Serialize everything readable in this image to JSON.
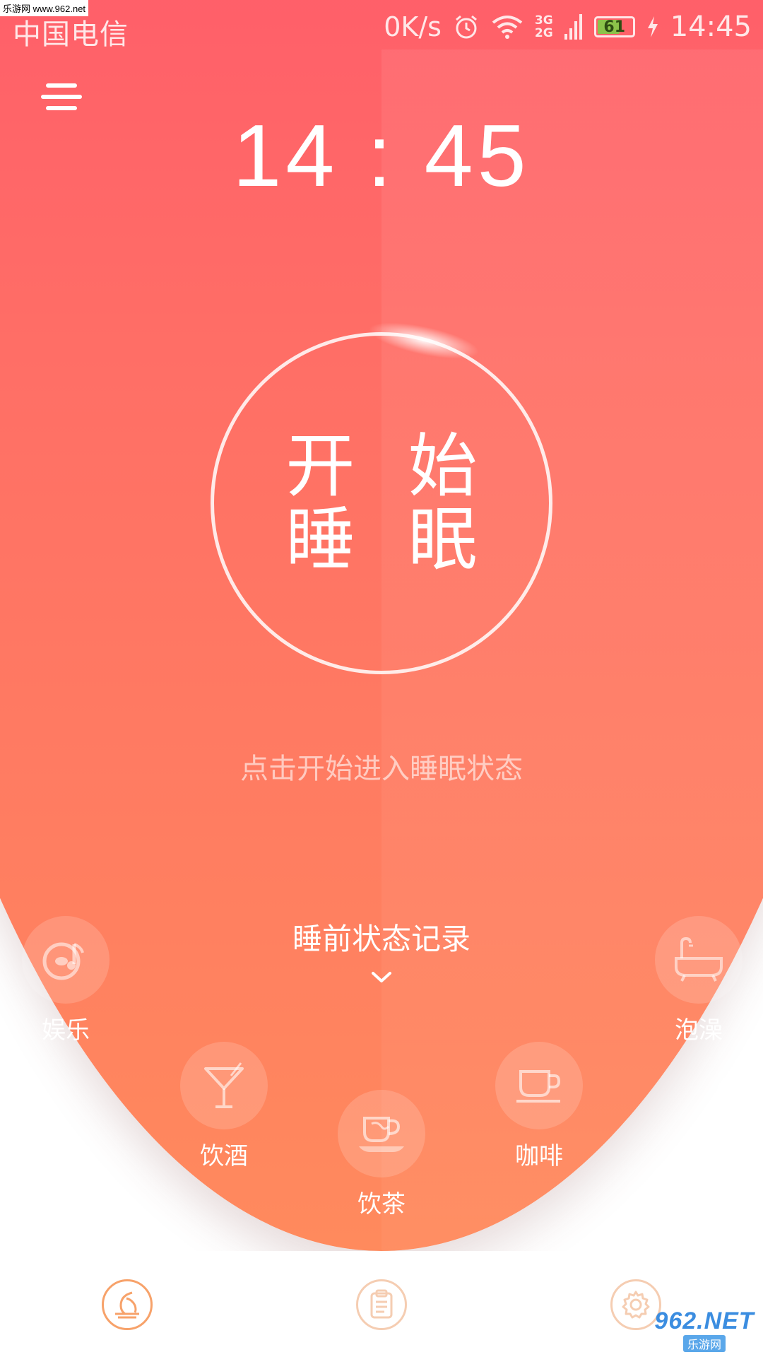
{
  "status_bar": {
    "watermark": "乐游网 www.962.net",
    "carrier": "中国电信",
    "net_speed": "0K/s",
    "network_gen": [
      "3G",
      "2G"
    ],
    "battery_level": "61",
    "time": "14:45"
  },
  "header": {
    "clock": "14 : 45"
  },
  "main": {
    "start_label_line1": "开 始",
    "start_label_line2": "睡 眠",
    "hint": "点击开始进入睡眠状态",
    "record_title": "睡前状态记录"
  },
  "activities": [
    {
      "label": "娱乐",
      "icon": "music-disc-icon"
    },
    {
      "label": "泡澡",
      "icon": "bathtub-icon"
    },
    {
      "label": "饮酒",
      "icon": "cocktail-glass-icon"
    },
    {
      "label": "咖啡",
      "icon": "coffee-cup-icon"
    },
    {
      "label": "饮茶",
      "icon": "tea-cup-icon"
    }
  ],
  "bottom_nav": [
    {
      "icon": "moon-sleep-icon",
      "active": true
    },
    {
      "icon": "clipboard-icon",
      "active": false
    },
    {
      "icon": "gear-icon",
      "active": false
    }
  ],
  "colors": {
    "gradient_top": "#ff5468",
    "gradient_bottom": "#ff8a5d",
    "nav_active": "#f7a26a",
    "nav_inactive": "#f5cdb2"
  },
  "watermark_bottom": {
    "brand": "962.NET",
    "site": "乐游网"
  }
}
